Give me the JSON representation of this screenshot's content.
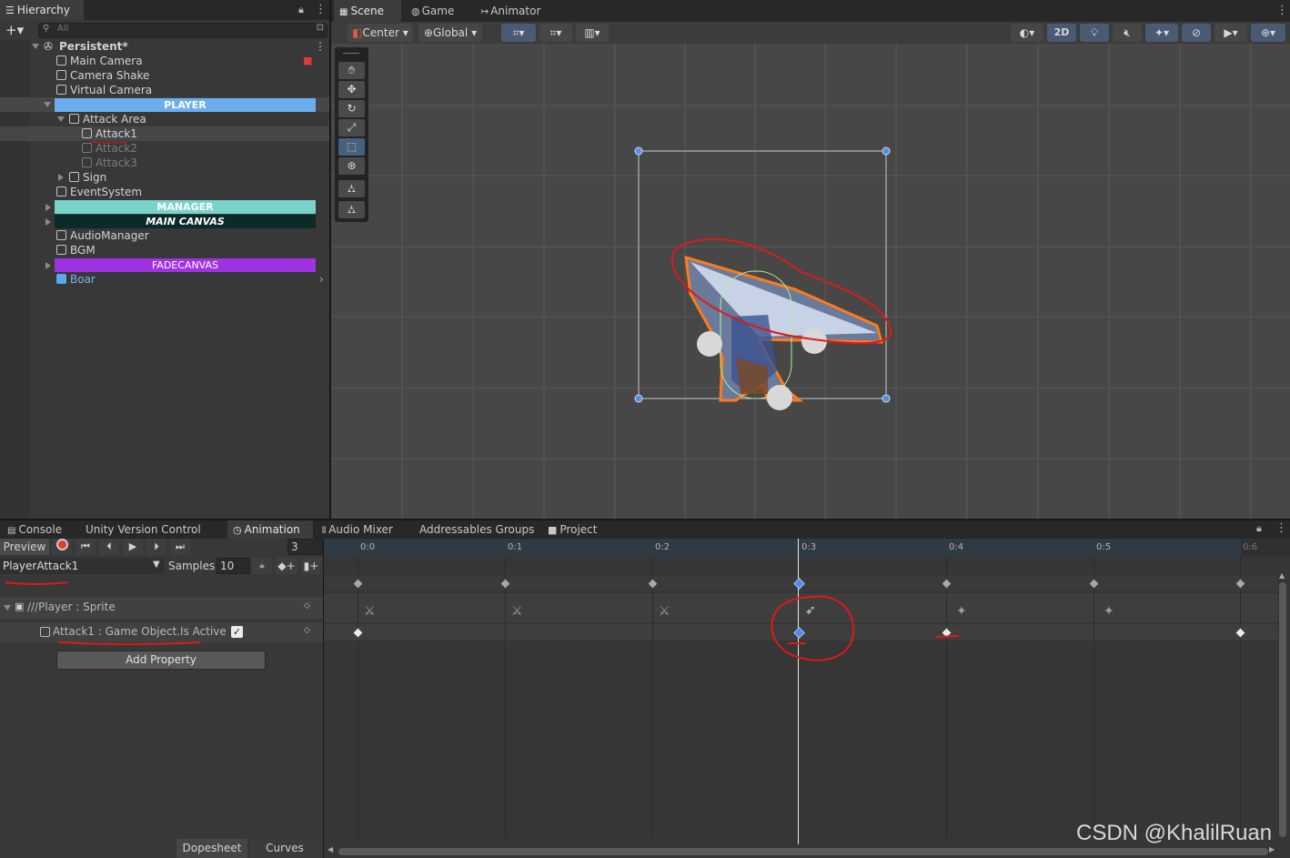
{
  "hierarchy": {
    "tab": "Hierarchy",
    "search_placeholder": "All",
    "scene": "Persistent*",
    "rows": {
      "main_camera": "Main Camera",
      "camera_shake": "Camera Shake",
      "virtual_camera": "Virtual Camera",
      "player": "PLAYER",
      "attack_area": "Attack Area",
      "attack1": "Attack1",
      "attack2": "Attack2",
      "attack3": "Attack3",
      "sign": "Sign",
      "event_system": "EventSystem",
      "manager": "MANAGER",
      "main_canvas": "MAIN CANVAS",
      "audio_manager": "AudioManager",
      "bgm": "BGM",
      "fadecanvas": "FADECANVAS",
      "boar": "Boar"
    },
    "colors": {
      "player": "#6aaef0",
      "manager": "#7ad3c8",
      "main_canvas": "#0d2a2a",
      "fadecanvas": "#a032e4"
    }
  },
  "scene_view": {
    "tabs": [
      "Scene",
      "Game",
      "Animator"
    ],
    "pivot": "Center",
    "space": "Global",
    "mode_2d": "2D"
  },
  "bottom": {
    "tabs": [
      "Console",
      "Unity Version Control",
      "Animation",
      "Audio Mixer",
      "Addressables Groups",
      "Project"
    ]
  },
  "animation": {
    "preview": "Preview",
    "frame": "3",
    "clip": "PlayerAttack1",
    "samples_label": "Samples",
    "samples": "10",
    "property_sprite": "///Player : Sprite",
    "property_active": "Attack1 : Game Object.Is Active",
    "add_property": "Add Property",
    "dopesheet": "Dopesheet",
    "curves": "Curves",
    "ticks": [
      "0:0",
      "0:1",
      "0:2",
      "0:3",
      "0:4",
      "0:5",
      "0:6"
    ]
  },
  "watermark": "CSDN @KhalilRuan"
}
